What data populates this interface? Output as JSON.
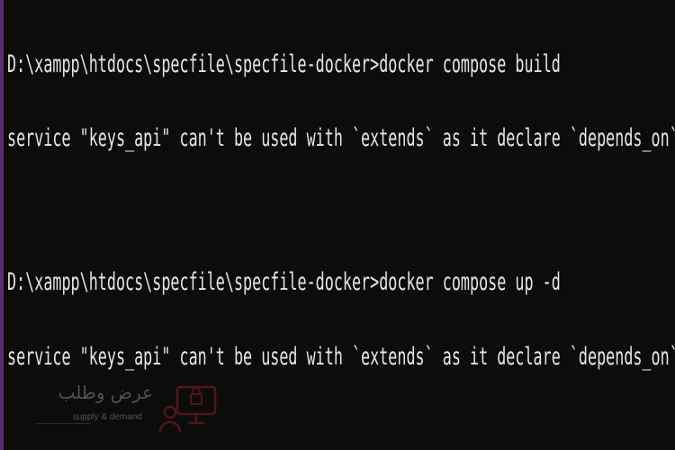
{
  "terminal": {
    "lines": [
      "D:\\xampp\\htdocs\\specfile\\specfile-docker>docker compose build",
      "service \"keys_api\" can't be used with `extends` as it declare `depends_on`",
      "D:\\xampp\\htdocs\\specfile\\specfile-docker>docker compose up -d",
      "service \"keys_api\" can't be used with `extends` as it declare `depends_on`"
    ]
  },
  "watermark": {
    "arabic_text": "عرض وطلب",
    "subtitle": "supply & demand",
    "icon": "shop-person-icon"
  },
  "colors": {
    "background": "#0c0c0c",
    "text": "#e6e6e6",
    "left_accent": "#5b2a73",
    "watermark_accent": "#8b1f1f"
  }
}
